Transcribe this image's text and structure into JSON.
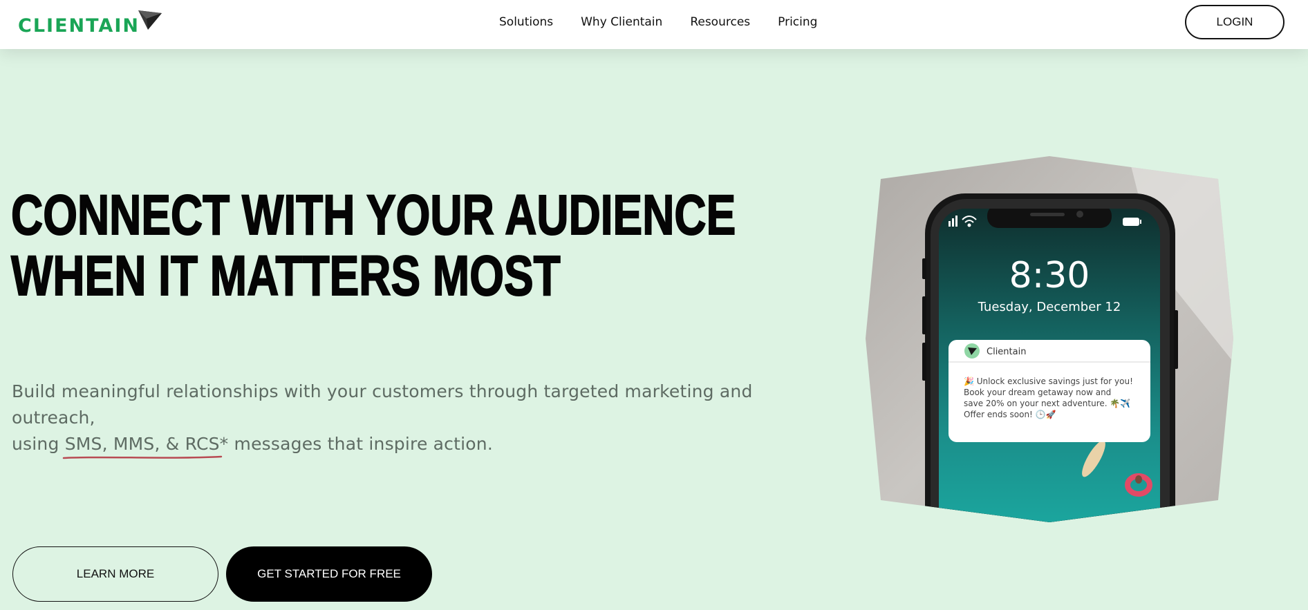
{
  "brand": {
    "name": "CLIENTAIN"
  },
  "nav": {
    "items": [
      "Solutions",
      "Why Clientain",
      "Resources",
      "Pricing"
    ],
    "login": "LOGIN"
  },
  "hero": {
    "headline_line1": "CONNECT WITH YOUR AUDIENCE",
    "headline_line2": "WHEN IT MATTERS MOST",
    "sub_part1": "Build meaningful relationships with your customers through targeted marketing and outreach,",
    "sub_part2": "using ",
    "sub_highlight": "SMS, MMS, & RCS*",
    "sub_part3": " messages that inspire action.",
    "learn_more": "LEARN MORE",
    "get_started": "GET STARTED FOR FREE"
  },
  "phone": {
    "time": "8:30",
    "date": "Tuesday, December 12",
    "notification": {
      "app": "Clientain",
      "line1": "🎉 Unlock exclusive savings just for you!",
      "line2": "Book your dream getaway now and",
      "line3": "save 20% on your next adventure. 🌴✈️",
      "line4": "Offer ends soon! 🕒🚀"
    }
  },
  "colors": {
    "brand_green": "#1aa556",
    "hero_bg": "#ddf3e3",
    "underline": "#b84a52"
  },
  "icons": [
    "paper-plane-logo-icon",
    "signal-icon",
    "wifi-icon",
    "battery-icon"
  ]
}
